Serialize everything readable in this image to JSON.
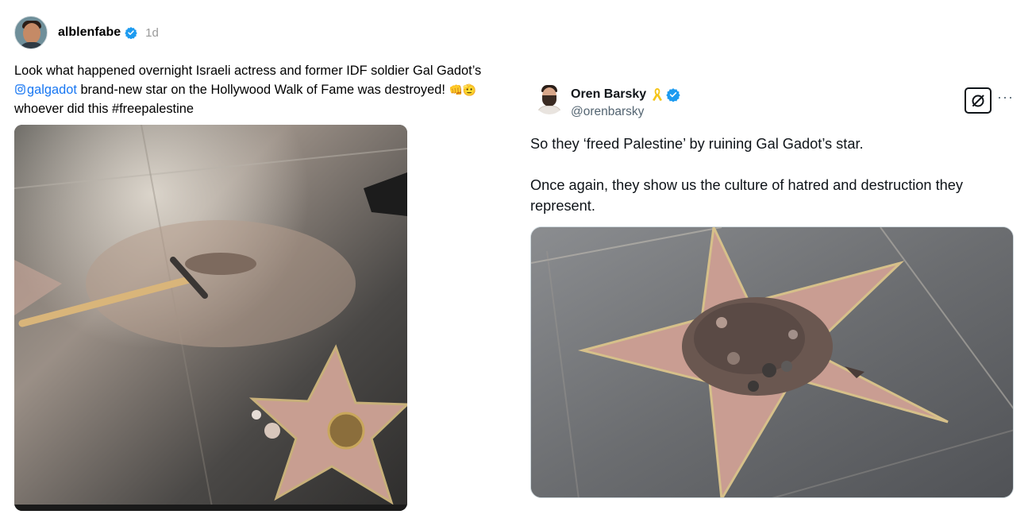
{
  "left_post": {
    "username": "alblenfabe",
    "time": "1d",
    "text_before_mention": "Look what happened overnight Israeli actress and former IDF soldier Gal Gadot’s ",
    "mention": "galgadot",
    "text_after_mention": " brand-new star on the Hollywood Walk of Fame was destroyed! ",
    "emojis": "👊🫡",
    "text_end": " whoever did this #freepalestine",
    "image": {
      "icon": "walk-of-fame-pickaxe-photo"
    }
  },
  "right_post": {
    "display_name": "Oren Barsky",
    "handle": "@orenbarsky",
    "paragraphs": [
      "So they ‘freed Palestine’ by ruining Gal Gadot’s star.",
      "Once again, they show us the culture of hatred and destruction they represent."
    ],
    "more_label": "···",
    "image": {
      "icon": "destroyed-star-photo"
    }
  },
  "colors": {
    "link": "#1877f2",
    "verified": "#1d9bf0",
    "secondary_text": "#536471",
    "ribbon": "#f5c518"
  }
}
